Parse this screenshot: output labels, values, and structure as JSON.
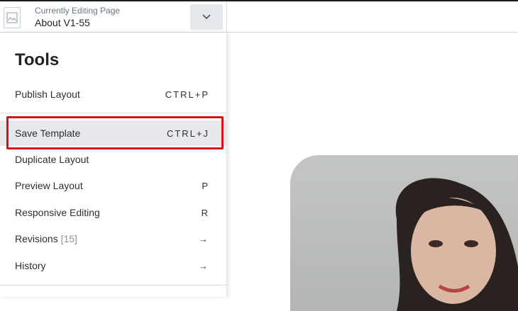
{
  "header": {
    "editing_label": "Currently Editing Page",
    "page_name": "About V1-55",
    "page_icon": "page-document-icon",
    "dropdown_icon": "chevron-down-icon"
  },
  "tools": {
    "title": "Tools",
    "items": [
      {
        "label": "Publish Layout",
        "shortcut": "CTRL+P"
      },
      {
        "label": "Save Template",
        "shortcut": "CTRL+J"
      },
      {
        "label": "Duplicate Layout",
        "shortcut": ""
      },
      {
        "label": "Preview Layout",
        "shortcut": "P"
      },
      {
        "label": "Responsive Editing",
        "shortcut": "R"
      },
      {
        "label": "Revisions",
        "count": "[15]",
        "shortcut": "→"
      },
      {
        "label": "History",
        "shortcut": "→"
      }
    ]
  },
  "colors": {
    "highlight_border": "#d7141a",
    "dropdown_bg": "#e4e7eb",
    "highlight_bg": "#e6e8eb"
  },
  "canvas": {
    "image": "portrait-photo-woman"
  }
}
